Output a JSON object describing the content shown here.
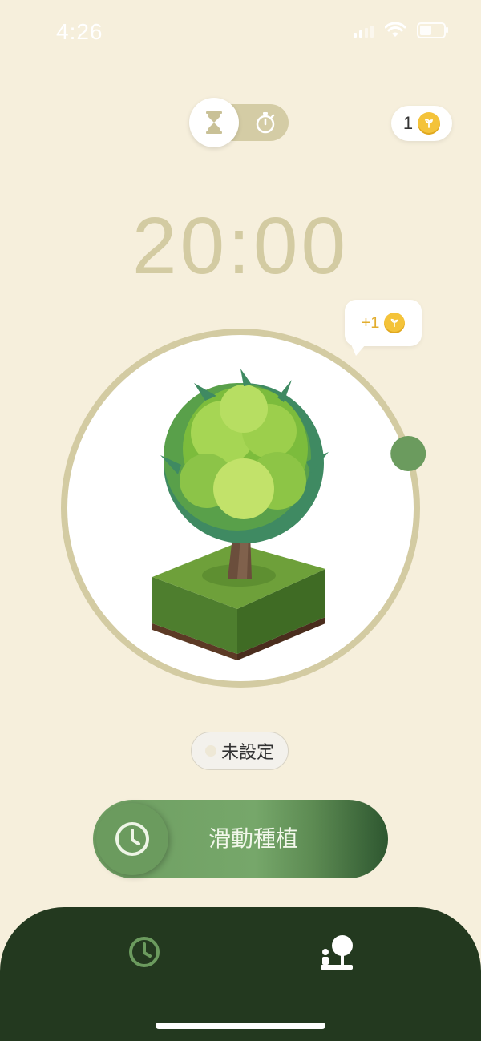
{
  "status_bar": {
    "time": "4:26"
  },
  "mode_toggle": {
    "active": "hourglass",
    "options": [
      "hourglass-icon",
      "stopwatch-icon"
    ]
  },
  "coins": {
    "count": "1"
  },
  "timer": {
    "display": "20:00",
    "progress": 0.2
  },
  "reward": {
    "text": "+1"
  },
  "tag": {
    "label": "未設定"
  },
  "plant_button": {
    "label": "滑動種植"
  },
  "tab_bar": {
    "items": [
      "clock-icon",
      "forest-icon"
    ]
  },
  "colors": {
    "background": "#f6efdc",
    "accent_green": "#6b9b5e",
    "dark_green": "#23391f",
    "ring": "#d3cba2",
    "coin": "#f4c33a"
  }
}
